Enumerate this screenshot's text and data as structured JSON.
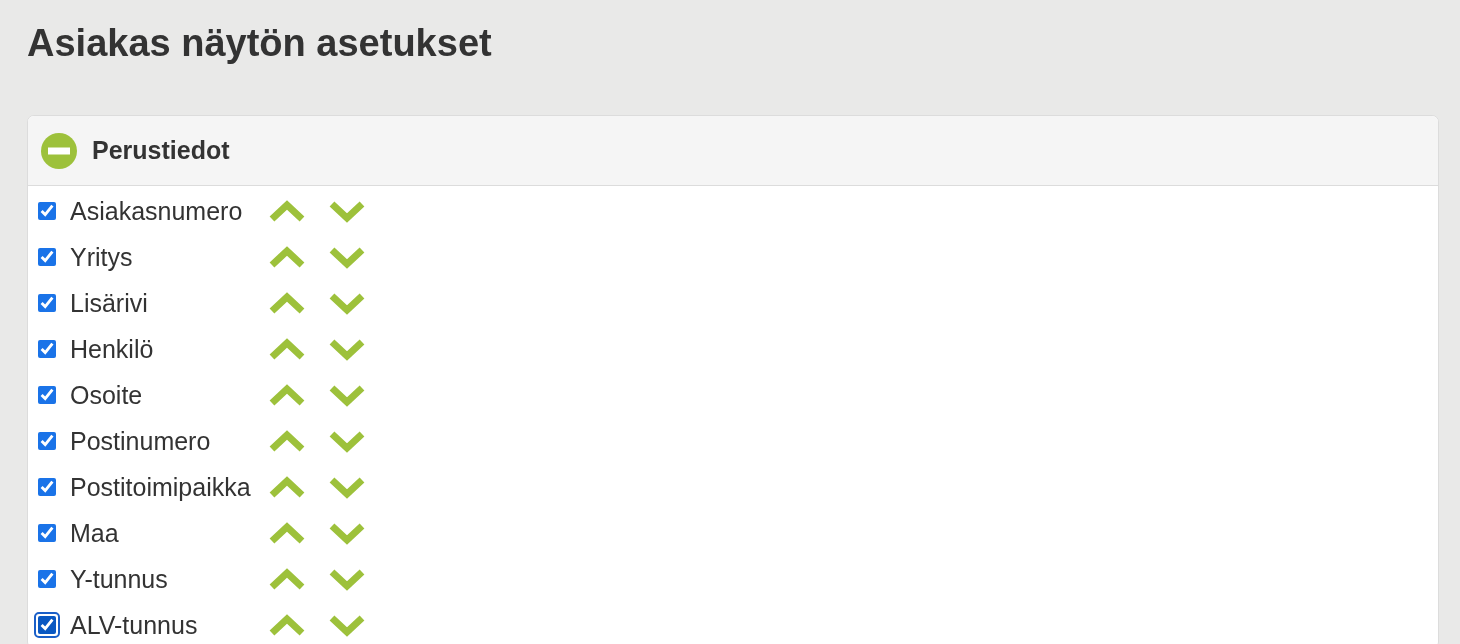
{
  "page": {
    "title": "Asiakas näytön asetukset"
  },
  "sections": [
    {
      "title": "Perustiedot",
      "expanded": true,
      "fields": [
        {
          "label": "Asiakasnumero",
          "checked": true,
          "focused": false
        },
        {
          "label": "Yritys",
          "checked": true,
          "focused": false
        },
        {
          "label": "Lisärivi",
          "checked": true,
          "focused": false
        },
        {
          "label": "Henkilö",
          "checked": true,
          "focused": false
        },
        {
          "label": "Osoite",
          "checked": true,
          "focused": false
        },
        {
          "label": "Postinumero",
          "checked": true,
          "focused": false
        },
        {
          "label": "Postitoimipaikka",
          "checked": true,
          "focused": false
        },
        {
          "label": "Maa",
          "checked": true,
          "focused": false
        },
        {
          "label": "Y-tunnus",
          "checked": true,
          "focused": false
        },
        {
          "label": "ALV-tunnus",
          "checked": true,
          "focused": true
        }
      ]
    }
  ]
}
